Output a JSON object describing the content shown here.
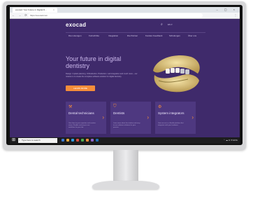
{
  "browser": {
    "tab_title": "exocad: Your Future in Digital D...",
    "tab_close": "×",
    "window_controls": "– ▢ ×",
    "nav_buttons": "← → ⟳",
    "url": "https://exocad.com",
    "menu_icon": "⋮"
  },
  "site": {
    "logo": "exocad",
    "search_icon": "⌕",
    "language": "EN ▾",
    "nav": [
      "Die Lösungen",
      "Fortschritte",
      "Integration",
      "Die Partner",
      "Kunden Feedback",
      "Schulungen",
      "Über uns"
    ],
    "hero_title": "Your future in digital dentistry",
    "hero_description": "Design. Implant planning. Orthodontics. Production. Lab integration and much more – our mission is to create the complete software solution for digital dentistry.",
    "cta": "LEARN MORE",
    "cards": [
      {
        "icon": "tooth-icon",
        "glyph": "⚒",
        "title": "Dental technicians",
        "text": "Give form to your expertise and creative vision. Flexible and easy to use workflows for your lab.",
        "arrow": "›"
      },
      {
        "icon": "chair-icon",
        "glyph": "⛉",
        "title": "Dentists",
        "text": "Learn more about the intuitive and easy to use software solutions for your practice.",
        "arrow": "›"
      },
      {
        "icon": "gear-icon",
        "glyph": "⚙",
        "title": "System integrators",
        "text": "Gain access to a flexible platform that integrates with your hardware.",
        "arrow": "›"
      }
    ]
  },
  "taskbar": {
    "start_glyph": "⊞",
    "search_placeholder": "Type here to search",
    "tray": "⌃ ☁ ⊡ ✉ ENG"
  },
  "colors": {
    "page_bg": "#3f2a6b",
    "accent": "#f58d3a",
    "card_bg": "#4e3880"
  }
}
